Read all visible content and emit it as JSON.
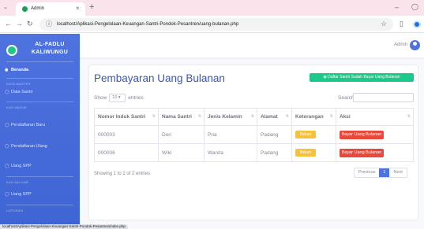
{
  "browser": {
    "tab_title": "Admin",
    "url": "localhost/Aplikasi-Pengelolaan-Keuangan-Santri-Pondok-Pesantren/uang-bulanan.php",
    "status_url": "localhost/Aplikasi-Pengelolaan-Keuangan-Santri-Pondok-Pesantren/index.php"
  },
  "sidebar": {
    "brand": "AL-FADLU KALIWUNGU",
    "dashboard": "Beranda",
    "sections": [
      {
        "heading": "DATA MASTER",
        "items": [
          "Data Santri"
        ]
      },
      {
        "heading": "KAS MASUK",
        "items": [
          "Pendaftaran Baru",
          "Pendaftaran Ulang",
          "Uang SPP"
        ]
      },
      {
        "heading": "KAS KELUAR",
        "items": [
          "Uang SPP"
        ]
      },
      {
        "heading": "LAPORAN",
        "items": []
      }
    ]
  },
  "topbar": {
    "user": "Admin"
  },
  "page": {
    "title": "Pembayaran Uang Bulanan",
    "paid_button": "Daftar Santri Sudah Bayar Uang Bulanan",
    "show_label": "Show",
    "show_value": "10",
    "entries_label": "entries",
    "search_label": "Search:",
    "info": "Showing 1 to 2 of 2 entries",
    "pagination": {
      "previous": "Previous",
      "current": "1",
      "next": "Next"
    }
  },
  "table": {
    "columns": [
      "Nomor Induk Santri",
      "Nama Santri",
      "Jenis Kelamin",
      "Alamat",
      "Keterangan",
      "Aksi"
    ],
    "rows": [
      {
        "nis": "000003",
        "nama": "Dori",
        "jk": "Pria",
        "alamat": "Padang",
        "keterangan": "Belum",
        "aksi": "Bayar Uang Bulanan"
      },
      {
        "nis": "000006",
        "nama": "Wiki",
        "jk": "Wanita",
        "alamat": "Padang",
        "keterangan": "Belum",
        "aksi": "Bayar Uang Bulanan"
      }
    ]
  },
  "colors": {
    "sidebar": "#4e73df",
    "success": "#1cc88a",
    "danger": "#e74a3b",
    "warning": "#f6c23e",
    "title": "#3a57b8"
  }
}
